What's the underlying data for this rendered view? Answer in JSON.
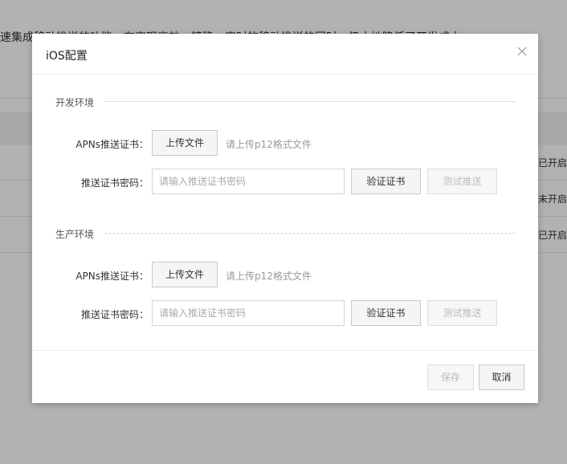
{
  "background": {
    "banner_text": "速集成移动推送的功能，在实现高效、精确、实时的移动推送的同时，极大地降低了开发成本",
    "rows": [
      {
        "status": "书已开启"
      },
      {
        "status": "书未开启"
      },
      {
        "status": "书已开启"
      }
    ]
  },
  "dialog": {
    "title": "iOS配置",
    "close_icon": "close-icon",
    "sections": [
      {
        "title": "开发环境",
        "apns_label": "APNs推送证书：",
        "upload_label": "上传文件",
        "upload_hint": "请上传p12格式文件",
        "password_label": "推送证书密码：",
        "password_placeholder": "请输入推送证书密码",
        "password_value": "",
        "verify_label": "验证证书",
        "test_label": "测试推送"
      },
      {
        "title": "生产环境",
        "apns_label": "APNs推送证书：",
        "upload_label": "上传文件",
        "upload_hint": "请上传p12格式文件",
        "password_label": "推送证书密码：",
        "password_placeholder": "请输入推送证书密码",
        "password_value": "",
        "verify_label": "验证证书",
        "test_label": "测试推送"
      }
    ],
    "footer": {
      "save_label": "保存",
      "cancel_label": "取消"
    }
  },
  "colors": {
    "overlay": "#000000",
    "button_bg": "#f5f5f5",
    "disabled_text": "#bbbbbb"
  }
}
